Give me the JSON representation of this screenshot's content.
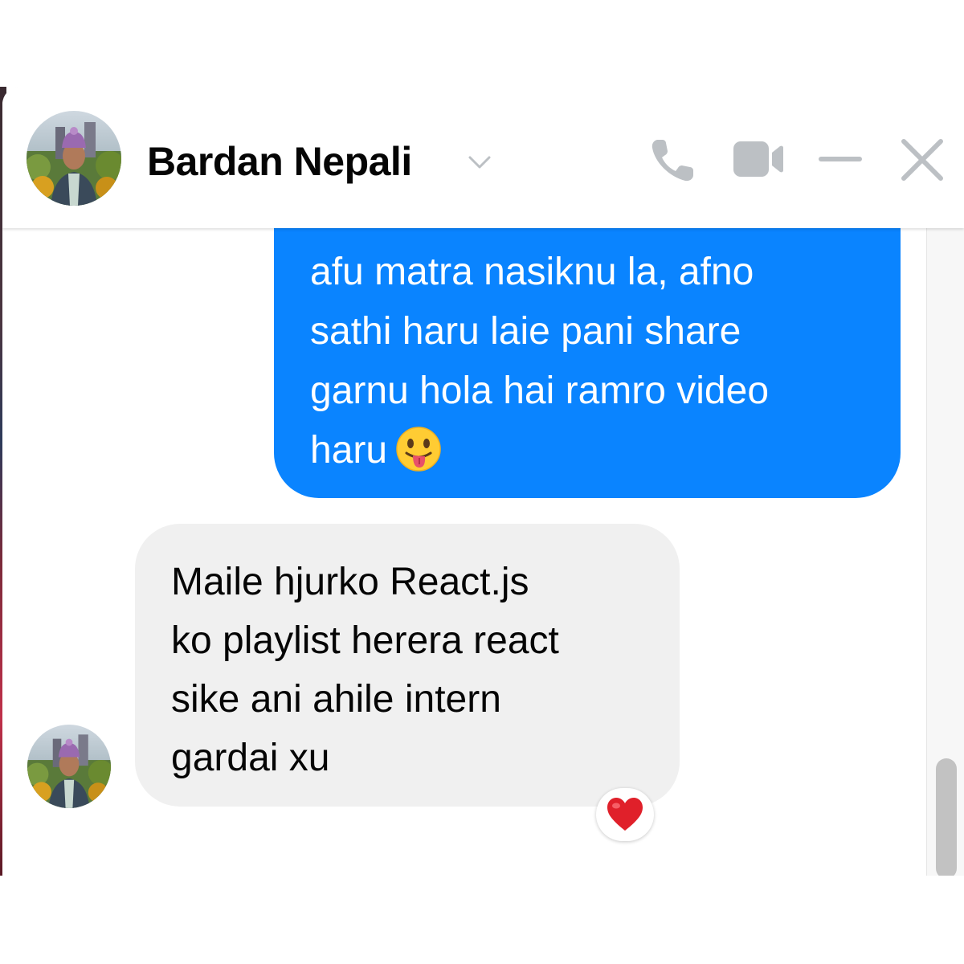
{
  "header": {
    "contact_name": "Bardan Nepali",
    "icons": [
      "chevron-down-icon",
      "phone-icon",
      "video-camera-icon",
      "minimize-icon",
      "close-icon"
    ]
  },
  "messages": [
    {
      "direction": "outgoing",
      "text": "afu matra nasiknu la, afno\nsathi haru laie pani share\ngarnu hola hai ramro video\nharu",
      "emoji": "😛"
    },
    {
      "direction": "incoming",
      "text": "Maile hjurko React.js\nko playlist herera react\nsike ani ahile intern\ngardai xu",
      "reaction": "❤️"
    }
  ],
  "colors": {
    "outgoing_bubble": "#0a84ff",
    "incoming_bubble": "#f0f0f0",
    "icon_gray": "#bcc0c4"
  }
}
